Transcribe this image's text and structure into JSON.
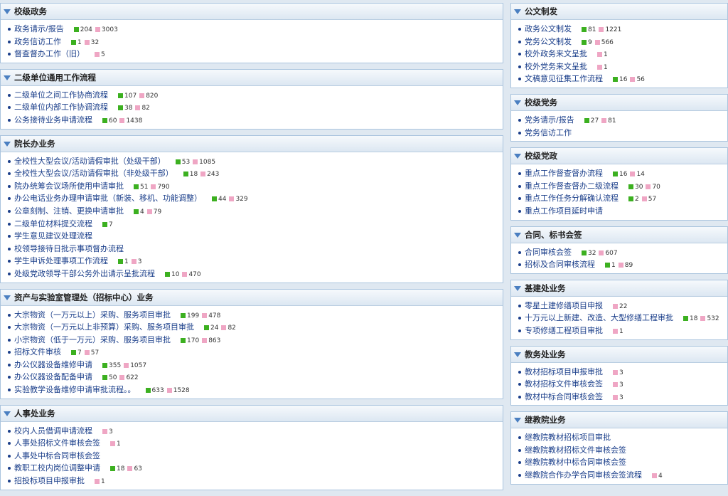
{
  "left_panels": [
    {
      "title": "校级政务",
      "items": [
        {
          "label": "政务请示/报告",
          "green": "204",
          "pink": "3003"
        },
        {
          "label": "政务信访工作",
          "green": "1",
          "pink": "32"
        },
        {
          "label": "督查督办工作（旧）",
          "green": "",
          "pink": "5"
        }
      ]
    },
    {
      "title": "二级单位通用工作流程",
      "items": [
        {
          "label": "二级单位之间工作协商流程",
          "green": "107",
          "pink": "820"
        },
        {
          "label": "二级单位内部工作协调流程",
          "green": "38",
          "pink": "82"
        },
        {
          "label": "公务接待业务申请流程",
          "green": "60",
          "pink": "1438"
        }
      ]
    },
    {
      "title": "院长办业务",
      "items": [
        {
          "label": "全校性大型会议/活动请假审批（处级干部）",
          "green": "53",
          "pink": "1085"
        },
        {
          "label": "全校性大型会议/活动请假审批（非处级干部）",
          "green": "18",
          "pink": "243"
        },
        {
          "label": "院办统筹会议场所使用申请审批",
          "green": "51",
          "pink": "790"
        },
        {
          "label": "办公电话业务办理申请审批（新装、移机、功能调整）",
          "green": "44",
          "pink": "329"
        },
        {
          "label": "公章刻制、注销、更换申请审批",
          "green": "4",
          "pink": "79"
        },
        {
          "label": "二级单位材料提交流程",
          "green": "7",
          "pink": ""
        },
        {
          "label": "学生意见建议处理流程",
          "green": "",
          "pink": ""
        },
        {
          "label": "校领导接待日批示事项督办流程",
          "green": "",
          "pink": ""
        },
        {
          "label": "学生申诉处理事项工作流程",
          "green": "1",
          "pink": "3"
        },
        {
          "label": "处级党政领导干部公务外出请示呈批流程",
          "green": "10",
          "pink": "470"
        }
      ]
    },
    {
      "title": "资产与实验室管理处（招标中心）业务",
      "items": [
        {
          "label": "大宗物资（一万元以上）采购、服务项目审批",
          "green": "199",
          "pink": "478"
        },
        {
          "label": "大宗物资（一万元以上非预算）采购、服务项目审批",
          "green": "24",
          "pink": "82"
        },
        {
          "label": "小宗物资（低于一万元）采购、服务项目审批",
          "green": "170",
          "pink": "863"
        },
        {
          "label": "招标文件审核",
          "green": "7",
          "pink": "57"
        },
        {
          "label": "办公仪器设备维修申请",
          "green": "355",
          "pink": "1057"
        },
        {
          "label": "办公仪器设备配备申请",
          "green": "50",
          "pink": "622"
        },
        {
          "label": "实验教学设备维修申请审批流程。。",
          "green": "633",
          "pink": "1528"
        }
      ]
    },
    {
      "title": "人事处业务",
      "items": [
        {
          "label": "校内人员借调申请流程",
          "green": "",
          "pink": "3"
        },
        {
          "label": "人事处招标文件审核会签",
          "green": "",
          "pink": "1"
        },
        {
          "label": "人事处中标合同审核会签",
          "green": "",
          "pink": ""
        },
        {
          "label": "教职工校内岗位调整申请",
          "green": "18",
          "pink": "63"
        },
        {
          "label": "招投标项目申报审批",
          "green": "",
          "pink": "1"
        }
      ]
    }
  ],
  "right_panels": [
    {
      "title": "公文制发",
      "items": [
        {
          "label": "政务公文制发",
          "green": "81",
          "pink": "1221"
        },
        {
          "label": "党务公文制发",
          "green": "9",
          "pink": "566"
        },
        {
          "label": "校外政务来文呈批",
          "green": "",
          "pink": "1"
        },
        {
          "label": "校外党务来文呈批",
          "green": "",
          "pink": "1"
        },
        {
          "label": "文稿意见征集工作流程",
          "green": "16",
          "pink": "56"
        }
      ]
    },
    {
      "title": "校级党务",
      "items": [
        {
          "label": "党务请示/报告",
          "green": "27",
          "pink": "81"
        },
        {
          "label": "党务信访工作",
          "green": "",
          "pink": ""
        }
      ]
    },
    {
      "title": "校级党政",
      "items": [
        {
          "label": "重点工作督查督办流程",
          "green": "16",
          "pink": "14"
        },
        {
          "label": "重点工作督查督办二级流程",
          "green": "30",
          "pink": "70"
        },
        {
          "label": "重点工作任务分解确认流程",
          "green": "2",
          "pink": "57"
        },
        {
          "label": "重点工作项目延时申请",
          "green": "",
          "pink": ""
        }
      ]
    },
    {
      "title": "合同、标书会签",
      "items": [
        {
          "label": "合同审核会签",
          "green": "32",
          "pink": "607"
        },
        {
          "label": "招标及合同审核流程",
          "green": "1",
          "pink": "89"
        }
      ]
    },
    {
      "title": "基建处业务",
      "items": [
        {
          "label": "零星土建修缮项目申报",
          "green": "",
          "pink": "22"
        },
        {
          "label": "十万元以上新建、改造、大型修缮工程审批",
          "green": "18",
          "pink": "532"
        },
        {
          "label": "专项修缮工程项目审批",
          "green": "",
          "pink": "1"
        }
      ]
    },
    {
      "title": "教务处业务",
      "items": [
        {
          "label": "教材招标项目申报审批",
          "green": "",
          "pink": "3"
        },
        {
          "label": "教材招标文件审核会签",
          "green": "",
          "pink": "3"
        },
        {
          "label": "教材中标合同审核会签",
          "green": "",
          "pink": "3"
        }
      ]
    },
    {
      "title": "继教院业务",
      "items": [
        {
          "label": "继教院教材招标项目审批",
          "green": "",
          "pink": ""
        },
        {
          "label": "继教院教材招标文件审核会签",
          "green": "",
          "pink": ""
        },
        {
          "label": "继教院教材中标合同审核会签",
          "green": "",
          "pink": ""
        },
        {
          "label": "继教院合作办学合同审核会签流程",
          "green": "",
          "pink": "4"
        }
      ]
    }
  ],
  "colors": {
    "accent": "#1a3e8a",
    "pending": "#3cb020",
    "done": "#efa6c4"
  }
}
